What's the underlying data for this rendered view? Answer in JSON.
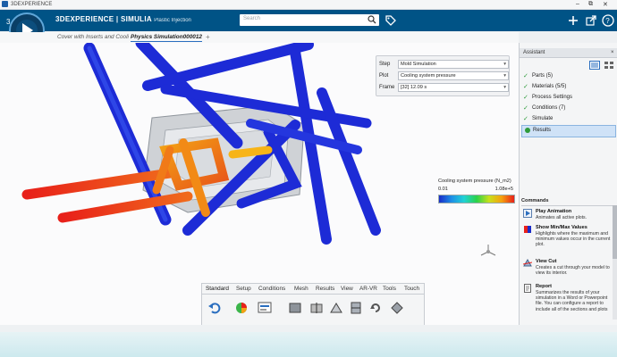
{
  "window": {
    "title": "3DEXPERIENCE",
    "controls": [
      "–",
      "⧉",
      "✕"
    ]
  },
  "topbar": {
    "brand_main": "3DEXPERIENCE | SIMULIA",
    "brand_sub": "Plastic Injection",
    "search_placeholder": "Search"
  },
  "tabs": {
    "doc1": "Cover with Inserts and Cooli",
    "doc2": "Physics Simulation000012",
    "add": "+"
  },
  "plot_panel": {
    "step_label": "Step",
    "step_value": "Mold Simulation",
    "plot_label": "Plot",
    "plot_value": "Cooling system pressure",
    "frame_label": "Frame",
    "frame_value": "[32]  12.09 s"
  },
  "legend": {
    "title": "Cooling system pressure (N_m2)",
    "min": "0.01",
    "max": "1.08e+5"
  },
  "assistant": {
    "title": "Assistant",
    "close": "×",
    "steps": [
      {
        "label": "Parts (5)",
        "done": true
      },
      {
        "label": "Materials (5/5)",
        "done": true
      },
      {
        "label": "Process Settings",
        "done": true
      },
      {
        "label": "Conditions (7)",
        "done": true
      },
      {
        "label": "Simulate",
        "done": true
      },
      {
        "label": "Results",
        "done": false,
        "active": true
      }
    ],
    "commands_title": "Commands",
    "commands": [
      {
        "name": "Play Animation",
        "desc": "Animates all active plots."
      },
      {
        "name": "Show Min/Max Values",
        "desc": "Highlights where the maximum and minimum values occur in the current plot."
      },
      {
        "name": "View Cut",
        "desc": "Creates a cut through your model to view its interior."
      },
      {
        "name": "Report",
        "desc": "Summarizes the results of your simulation in a Word or Powerpoint file. You can configure a report to include all of the sections and plots"
      }
    ]
  },
  "actionbar": {
    "tabs": [
      "Standard",
      "Setup",
      "Conditions",
      "Mesh",
      "Results",
      "View",
      "AR-VR",
      "Tools",
      "Touch"
    ],
    "active_tab": "Standard"
  },
  "colors": {
    "topbar": "#005386",
    "cold": "#1a2cc8",
    "hot": "#e8201a",
    "accent": "#2a6ebf"
  }
}
